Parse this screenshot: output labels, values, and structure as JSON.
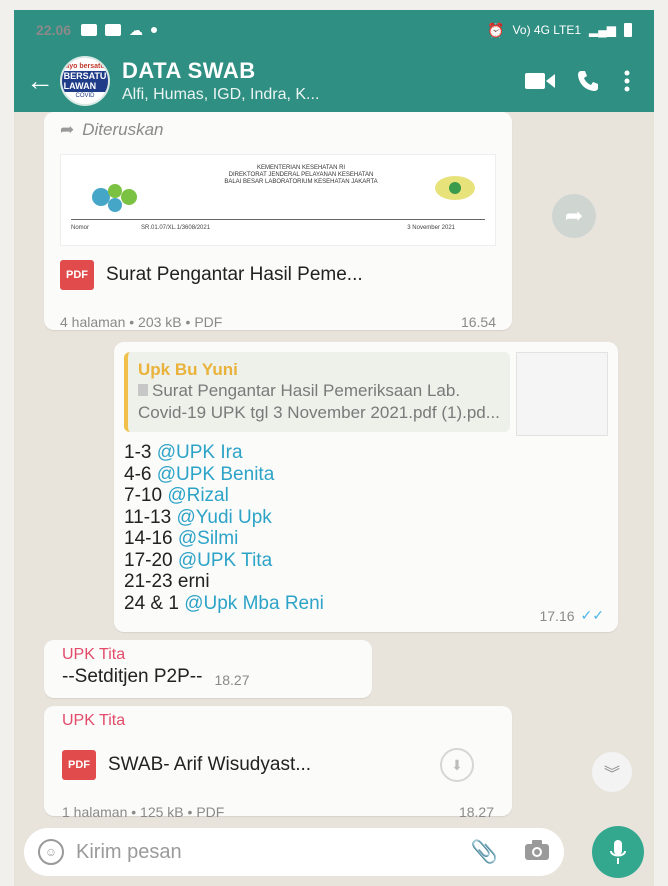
{
  "status": {
    "time": "22.06",
    "network": "Vo) 4G LTE1"
  },
  "header": {
    "title": "DATA SWAB",
    "subtitle": "Alfi, Humas, IGD, Indra, K...",
    "avatar_top": "ayo bersatu",
    "avatar_mid": "BERSATU LAWAN",
    "avatar_bot": "COVID"
  },
  "msg1": {
    "forwarded_label": "Diteruskan",
    "doc_header": "KEMENTERIAN KESEHATAN RI\nDIREKTORAT JENDERAL PELAYANAN KESEHATAN\nBALAI BESAR LABORATORIUM KESEHATAN JAKARTA",
    "doc_nomor": "Nomor",
    "doc_ref": "SR.01.07/XL.1/3608/2021",
    "doc_date": "3 November 2021",
    "doc_name": "Surat Pengantar Hasil Peme...",
    "meta": "4 halaman • 203 kB • PDF",
    "time": "16.54"
  },
  "msg2": {
    "quote_name": "Upk Bu Yuni",
    "quote_text": "Surat Pengantar Hasil Pemeriksaan Lab. Covid-19 UPK tgl 3 November 2021.pdf (1).pd...",
    "lines": [
      {
        "prefix": "1-3 ",
        "mention": "@UPK Ira"
      },
      {
        "prefix": "4-6 ",
        "mention": "@UPK Benita"
      },
      {
        "prefix": "7-10 ",
        "mention": "@Rizal"
      },
      {
        "prefix": "11-13 ",
        "mention": "@Yudi Upk"
      },
      {
        "prefix": "14-16 ",
        "mention": "@Silmi"
      },
      {
        "prefix": "17-20 ",
        "mention": "@UPK Tita"
      },
      {
        "prefix": "21-23 erni",
        "mention": ""
      },
      {
        "prefix": "24 & 1 ",
        "mention": "@Upk Mba Reni"
      }
    ],
    "time": "17.16"
  },
  "msg3": {
    "sender": "UPK Tita",
    "text": "--Setditjen P2P--",
    "time": "18.27"
  },
  "msg4": {
    "sender": "UPK Tita",
    "doc_name": "SWAB- Arif Wisudyast...",
    "meta": "1 halaman • 125 kB • PDF",
    "time": "18.27"
  },
  "input": {
    "placeholder": "Kirim pesan"
  },
  "colors": {
    "header": "#2f8f82",
    "mention": "#2da3c8",
    "sender": "#e24b6a",
    "quote_bar": "#f0c04a",
    "pdf": "#e14b4b"
  }
}
